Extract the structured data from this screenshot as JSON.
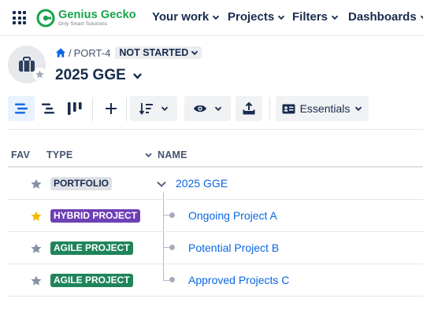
{
  "brand": {
    "name": "Genius Gecko",
    "tagline": "Only Smart Solutions",
    "color": "#16a34a"
  },
  "nav": {
    "apps_icon": "app-grid-icon",
    "items": [
      {
        "label": "Your work"
      },
      {
        "label": "Projects"
      },
      {
        "label": "Filters"
      },
      {
        "label": "Dashboards"
      }
    ]
  },
  "header": {
    "avatar_icon": "briefcase-icon",
    "breadcrumb": {
      "home_icon": "home-icon",
      "separator": "/",
      "key": "PORT-4"
    },
    "status": "NOT STARTED",
    "title": "2025 GGE"
  },
  "toolbar": {
    "buttons": [
      {
        "icon": "list-view-icon",
        "active": true
      },
      {
        "icon": "tree-view-icon",
        "active": false
      },
      {
        "icon": "board-view-icon",
        "active": false
      },
      {
        "icon": "plus-icon"
      },
      {
        "icon": "sort-icon"
      },
      {
        "icon": "eye-icon"
      },
      {
        "icon": "export-icon"
      }
    ],
    "essentials_label": "Essentials",
    "active_color": "#0c66e4"
  },
  "table": {
    "columns": {
      "fav": "FAV",
      "type": "TYPE",
      "name": "NAME"
    },
    "rows": [
      {
        "favorite": false,
        "type": "PORTFOLIO",
        "name": "2025 GGE",
        "expanded": true
      },
      {
        "favorite": true,
        "type": "HYBRID PROJECT",
        "name": "Ongoing Project A"
      },
      {
        "favorite": false,
        "type": "AGILE PROJECT",
        "name": "Potential Project B"
      },
      {
        "favorite": false,
        "type": "AGILE PROJECT",
        "name": "Approved Projects C"
      }
    ]
  },
  "colors": {
    "portfolio_badge": "#dfe1e6",
    "hybrid_badge": "#6e3fb5",
    "agile_badge": "#1f845a",
    "link": "#0c66e4",
    "star_on": "#f5b800",
    "star_off": "#8590a2"
  }
}
